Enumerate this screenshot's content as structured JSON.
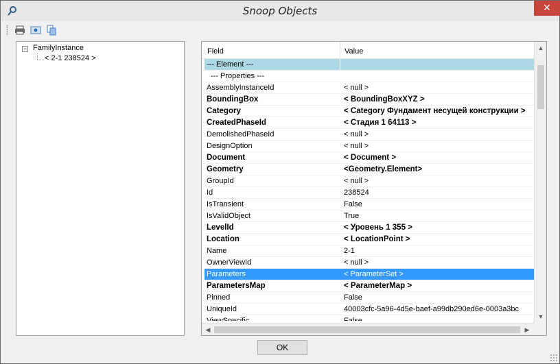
{
  "window": {
    "title": "Snoop Objects",
    "close_glyph": "✕"
  },
  "toolbar": {
    "icons": [
      "print-icon",
      "print-preview-icon",
      "copy-icon"
    ]
  },
  "tree": {
    "root": {
      "label": "FamilyInstance",
      "expander": "−"
    },
    "child": {
      "label": "< 2-1  238524 >"
    }
  },
  "grid": {
    "columns": {
      "field": "Field",
      "value": "Value"
    },
    "rows": [
      {
        "field": "--- Element ---",
        "value": "",
        "style": "hdr1"
      },
      {
        "field": "--- Properties ---",
        "value": "",
        "style": "hdr2"
      },
      {
        "field": "AssemblyInstanceId",
        "value": "< null >",
        "style": ""
      },
      {
        "field": "BoundingBox",
        "value": "< BoundingBoxXYZ >",
        "style": "bold"
      },
      {
        "field": "Category",
        "value": "< Category  Фундамент несущей конструкции >",
        "style": "bold"
      },
      {
        "field": "CreatedPhaseId",
        "value": "< Стадия 1  64113 >",
        "style": "bold"
      },
      {
        "field": "DemolishedPhaseId",
        "value": "< null >",
        "style": ""
      },
      {
        "field": "DesignOption",
        "value": "< null >",
        "style": ""
      },
      {
        "field": "Document",
        "value": "< Document >",
        "style": "bold"
      },
      {
        "field": "Geometry",
        "value": "<Geometry.Element>",
        "style": "bold"
      },
      {
        "field": "GroupId",
        "value": "< null >",
        "style": ""
      },
      {
        "field": "Id",
        "value": "238524",
        "style": ""
      },
      {
        "field": "IsTransient",
        "value": "False",
        "style": ""
      },
      {
        "field": "IsValidObject",
        "value": "True",
        "style": ""
      },
      {
        "field": "LevelId",
        "value": "< Уровень 1  355 >",
        "style": "bold"
      },
      {
        "field": "Location",
        "value": "< LocationPoint >",
        "style": "bold"
      },
      {
        "field": "Name",
        "value": "2-1",
        "style": ""
      },
      {
        "field": "OwnerViewId",
        "value": "< null >",
        "style": ""
      },
      {
        "field": "Parameters",
        "value": "< ParameterSet >",
        "style": "sel"
      },
      {
        "field": "ParametersMap",
        "value": "< ParameterMap >",
        "style": "bold"
      },
      {
        "field": "Pinned",
        "value": "False",
        "style": ""
      },
      {
        "field": "UniqueId",
        "value": "40003cfc-5a96-4d5e-baef-a99db290ed6e-0003a3bc",
        "style": ""
      },
      {
        "field": "ViewSpecific",
        "value": "False",
        "style": ""
      }
    ]
  },
  "buttons": {
    "ok": "OK"
  },
  "colors": {
    "selection": "#3399ff",
    "section_header": "#add8e6",
    "close": "#c7453b"
  }
}
